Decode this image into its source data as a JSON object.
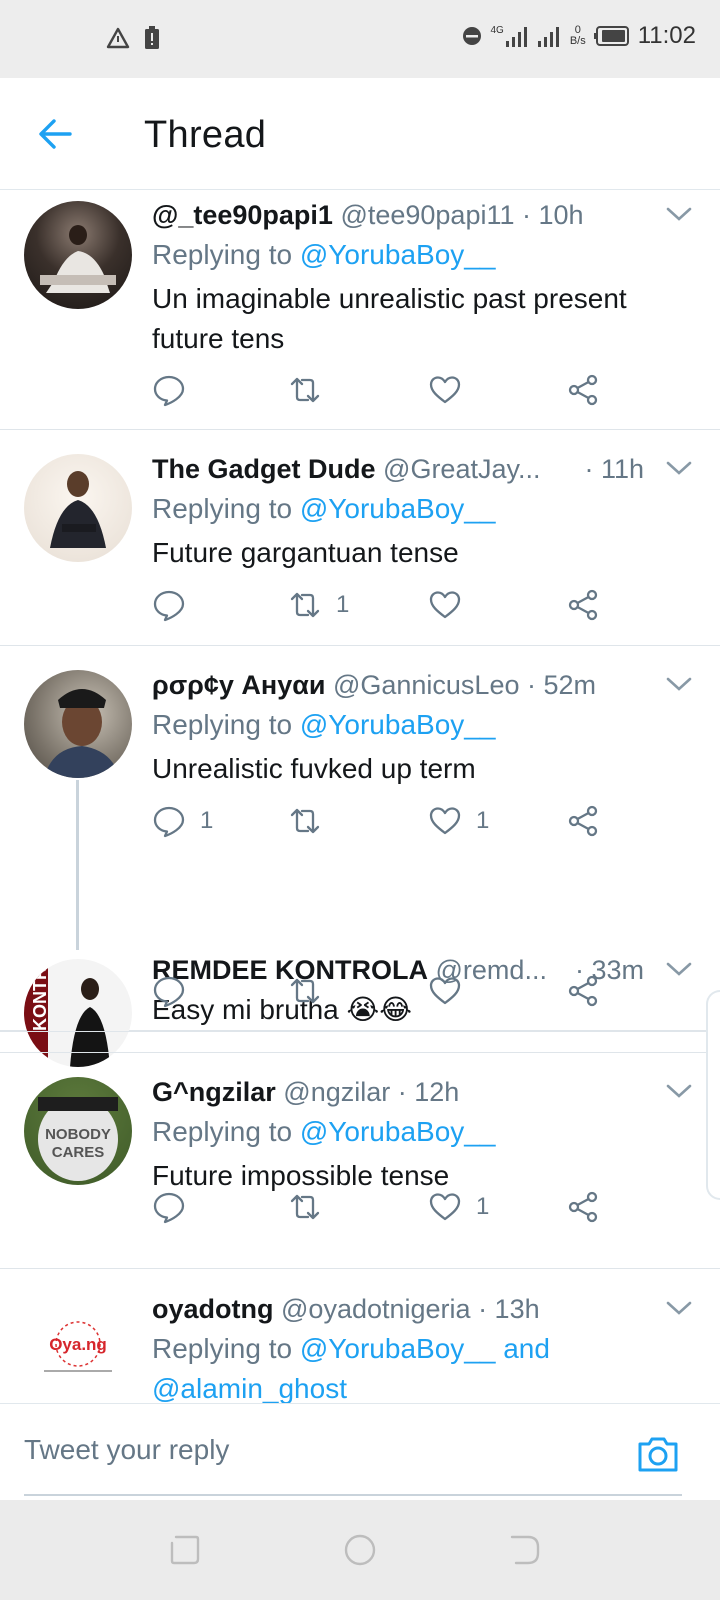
{
  "status_bar": {
    "time": "11:02",
    "network_type": "4G",
    "data_speed_value": "0",
    "data_speed_unit": "B/s"
  },
  "header": {
    "title": "Thread"
  },
  "tweets": [
    {
      "name": "@_tee90papi1",
      "handle": "@tee90papi11",
      "time": "· 10h",
      "replying_prefix": "Replying to ",
      "replying_to": "@YorubaBoy__",
      "text": "Un imaginable unrealistic past present future tens",
      "reply_count": "",
      "retweet_count": "",
      "like_count": ""
    },
    {
      "name": "The Gadget Dude",
      "handle": "@GreatJay...",
      "time": "· 11h",
      "replying_prefix": "Replying to ",
      "replying_to": "@YorubaBoy__",
      "text": "Future gargantuan tense",
      "reply_count": "",
      "retweet_count": "1",
      "like_count": ""
    },
    {
      "name": "ρσρ¢у Ануαи",
      "handle": "@GannicusLeo",
      "time": "· 52m",
      "replying_prefix": "Replying to ",
      "replying_to": "@YorubaBoy__",
      "text": "Unrealistic fuvked up term",
      "reply_count": "1",
      "retweet_count": "",
      "like_count": "1"
    },
    {
      "name": "REMDEE KONTROLA",
      "handle": "@remd...",
      "time": "· 33m",
      "text": "Easy mi brutha 😭😂",
      "reply_count": "",
      "retweet_count": "",
      "like_count": ""
    },
    {
      "name": "G^ngzilar",
      "handle": "@ngzilar",
      "time": "· 12h",
      "replying_prefix": "Replying to ",
      "replying_to": "@YorubaBoy__",
      "text": "Future impossible tense",
      "reply_count": "",
      "retweet_count": "",
      "like_count": "1"
    },
    {
      "name": "oyadotng",
      "handle": "@oyadotnigeria",
      "time": "· 13h",
      "replying_prefix": "Replying to ",
      "replying_to": "@YorubaBoy__ and",
      "replying_to_2": "@alamin_ghost",
      "avatar_logo": "Oya.ng"
    }
  ],
  "reply_bar": {
    "placeholder": "Tweet your reply"
  },
  "colors": {
    "accent": "#1da1f2",
    "text": "#14171a",
    "muted": "#657786",
    "divider": "#dfe5ea",
    "system_bar": "#ededed"
  },
  "icons": {
    "back": "arrow-left-icon",
    "chevron": "chevron-down-icon",
    "reply": "reply-bubble-icon",
    "retweet": "retweet-icon",
    "like": "heart-icon",
    "share": "share-icon",
    "camera": "camera-icon"
  }
}
